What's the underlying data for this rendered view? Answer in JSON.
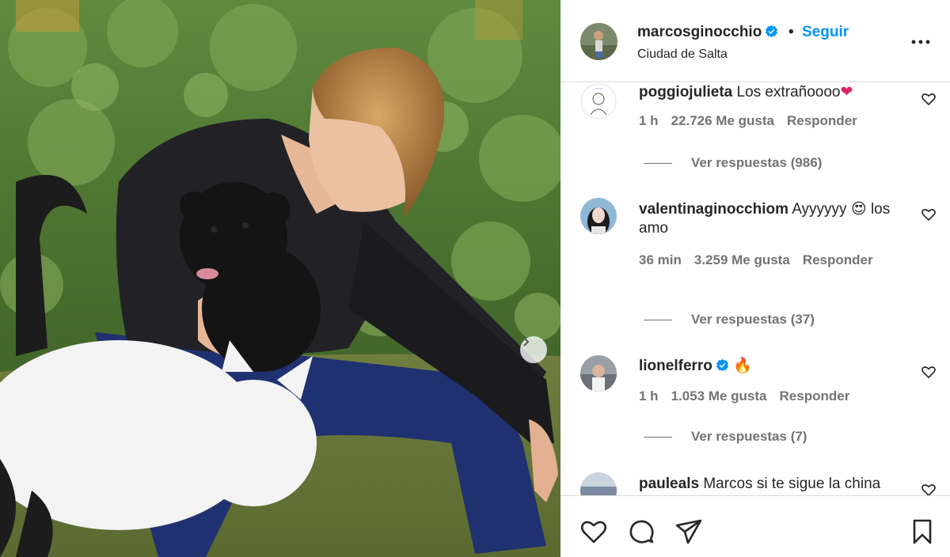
{
  "post": {
    "photo_icon": "next-arrow-icon"
  },
  "header": {
    "username": "marcosginocchio",
    "separator": "•",
    "follow_label": "Seguir",
    "location": "Ciudad de Salta"
  },
  "comments": [
    {
      "username": "poggiojulieta",
      "text": "Los extrañoooo",
      "emoji": "❤",
      "time": "1 h",
      "likes": "22.726 Me gusta",
      "reply": "Responder",
      "replies": "Ver respuestas (986)"
    },
    {
      "username": "valentinaginocchiom",
      "text": "Ayyyyyy",
      "emoji": "😍",
      "text2": "los",
      "text3": "amo",
      "time": "36 min",
      "likes": "3.259 Me gusta",
      "reply": "Responder",
      "replies": "Ver respuestas (37)"
    },
    {
      "username": "lionelferro",
      "text": "",
      "emoji": "🔥",
      "time": "1 h",
      "likes": "1.053 Me gusta",
      "reply": "Responder",
      "replies": "Ver respuestas (7)"
    },
    {
      "username": "pauleals",
      "text": "Marcos si te sigue la china"
    }
  ],
  "colors": {
    "link_blue": "#0095f6",
    "text": "#262626",
    "secondary": "#737373",
    "divider": "#dbdbdb"
  },
  "icons": [
    "verified-badge-icon",
    "more-options-icon",
    "heart-icon",
    "comment-icon",
    "share-icon",
    "bookmark-icon"
  ]
}
